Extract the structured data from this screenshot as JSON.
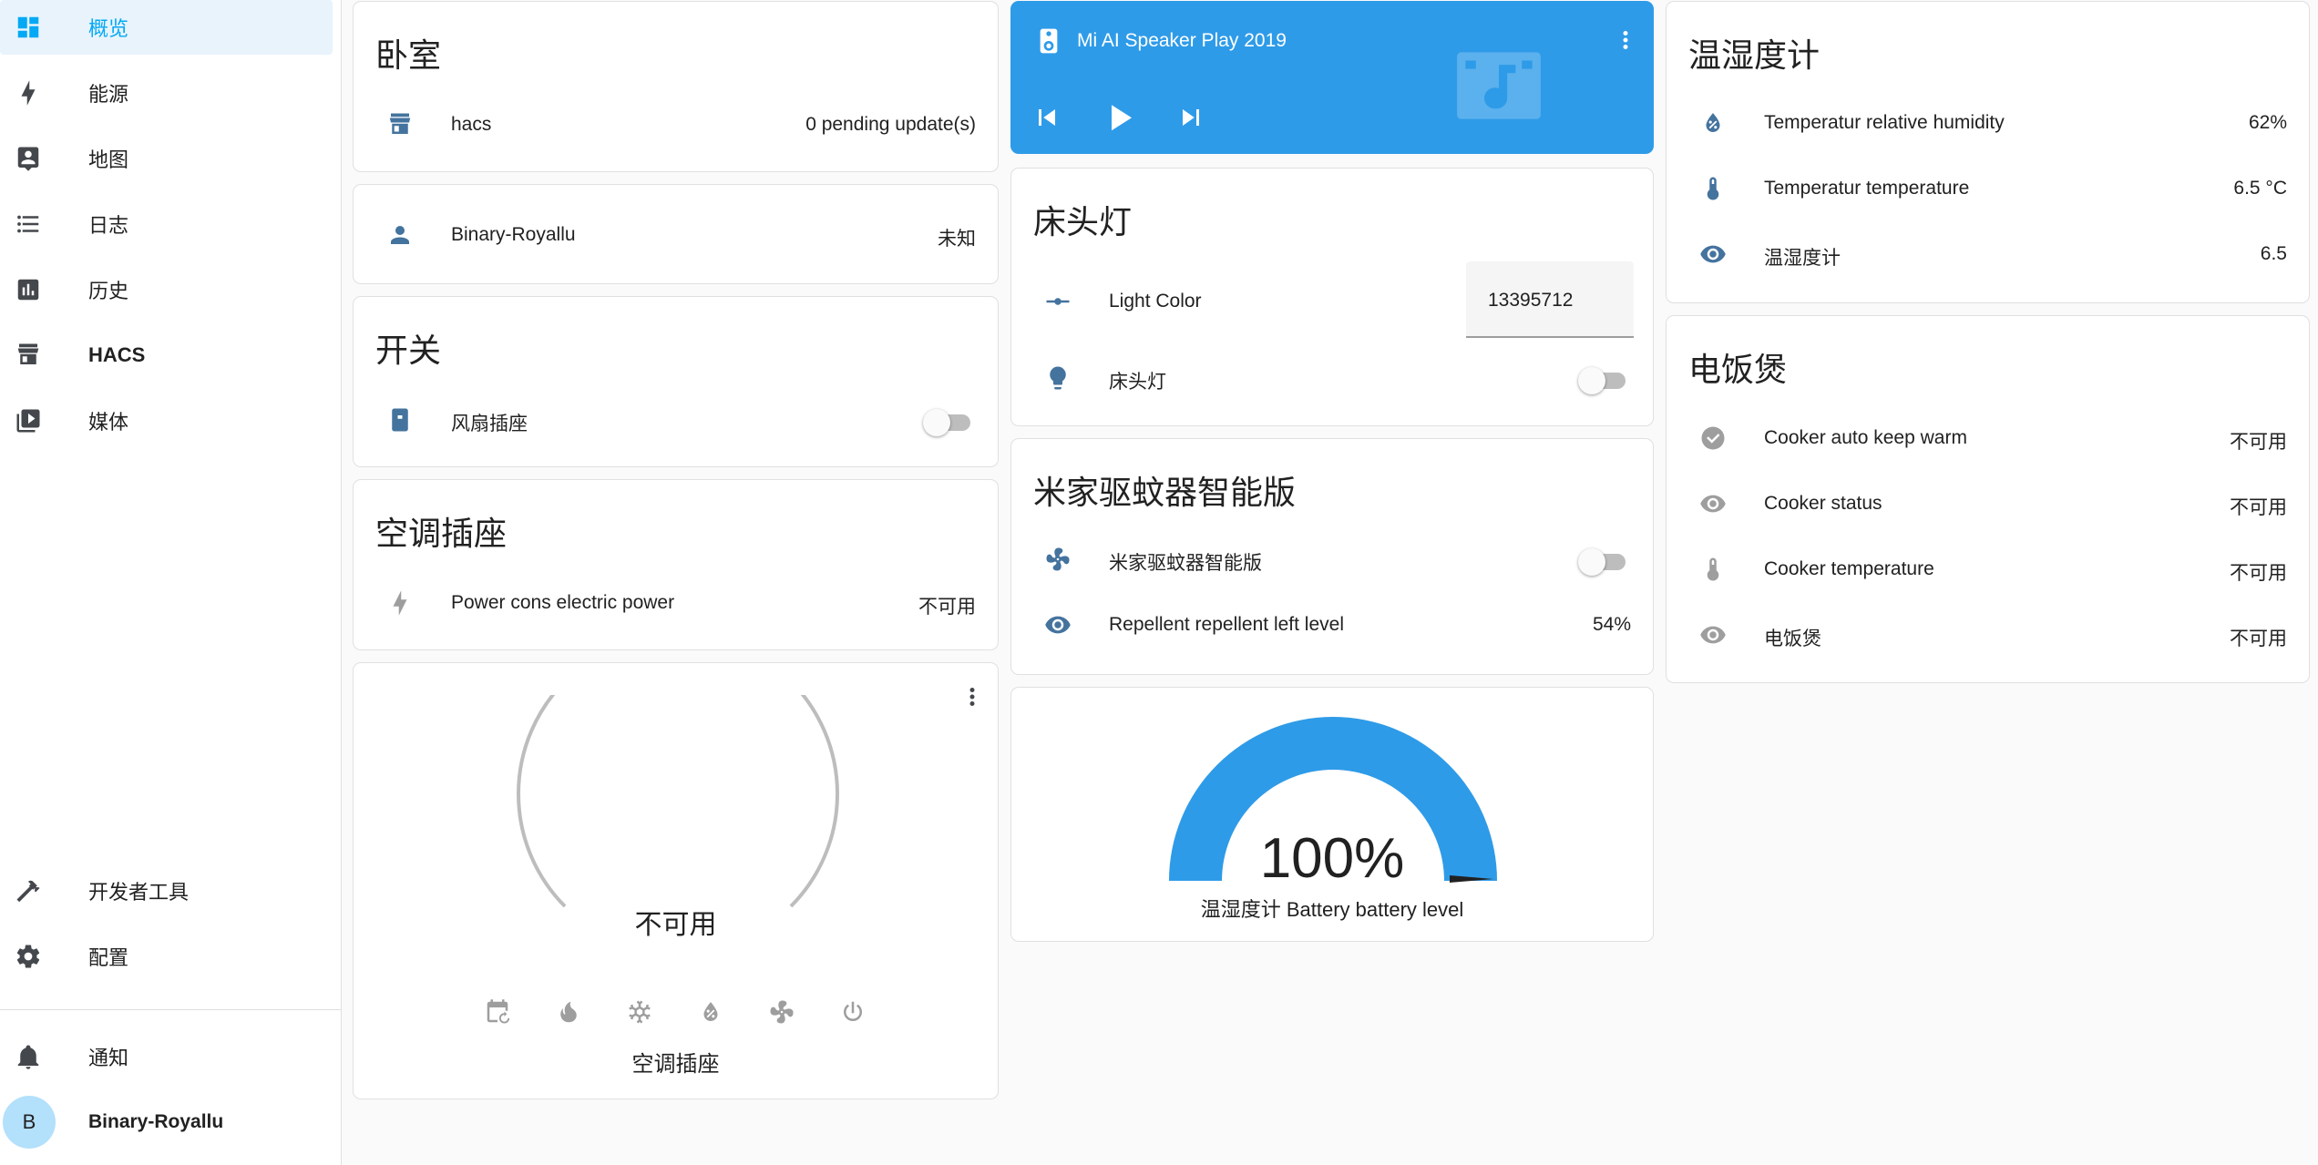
{
  "sidebar": {
    "items": [
      {
        "label": "概览",
        "icon": "dashboard-icon"
      },
      {
        "label": "能源",
        "icon": "lightning-icon"
      },
      {
        "label": "地图",
        "icon": "map-account-icon"
      },
      {
        "label": "日志",
        "icon": "format-list-icon"
      },
      {
        "label": "历史",
        "icon": "chart-box-icon"
      },
      {
        "label": "HACS",
        "icon": "hacs-store-icon"
      },
      {
        "label": "媒体",
        "icon": "play-box-multiple-icon"
      },
      {
        "label": "开发者工具",
        "icon": "hammer-icon"
      },
      {
        "label": "配置",
        "icon": "gear-icon"
      },
      {
        "label": "通知",
        "icon": "bell-icon"
      }
    ],
    "user": {
      "initial": "B",
      "name": "Binary-Royallu"
    },
    "accent": "#03a9f4"
  },
  "bedroom": {
    "title": "卧室",
    "hacs_name": "hacs",
    "hacs_value": "0 pending update(s)"
  },
  "person": {
    "name": "Binary-Royallu",
    "value": "未知"
  },
  "switch_card": {
    "title": "开关",
    "item_name": "风扇插座"
  },
  "ac_plug": {
    "title": "空调插座",
    "item_name": "Power cons electric power",
    "item_value": "不可用"
  },
  "thermostat": {
    "state": "不可用",
    "name": "空调插座",
    "modes": [
      "calendar-sync-icon",
      "fire-icon",
      "snowflake-icon",
      "water-percent-icon",
      "fan-icon",
      "power-icon"
    ]
  },
  "media": {
    "title": "Mi AI Speaker Play 2019",
    "bg_color": "#2e9be8"
  },
  "bedside": {
    "title": "床头灯",
    "light_color_name": "Light Color",
    "light_color_value": "13395712",
    "lamp_name": "床头灯"
  },
  "repeller": {
    "title": "米家驱蚊器智能版",
    "switch_name": "米家驱蚊器智能版",
    "level_name": "Repellent repellent left level",
    "level_value": "54%"
  },
  "gauge": {
    "value_text": "100%",
    "name": "温湿度计 Battery battery level",
    "fraction": 1.0,
    "color": "#2e9be8"
  },
  "hygrometer": {
    "title": "温湿度计",
    "rows": [
      {
        "name": "Temperatur relative humidity",
        "value": "62%"
      },
      {
        "name": "Temperatur temperature",
        "value": "6.5 °C"
      },
      {
        "name": "温湿度计",
        "value": "6.5"
      }
    ]
  },
  "cooker": {
    "title": "电饭煲",
    "rows": [
      {
        "name": "Cooker auto keep warm",
        "value": "不可用"
      },
      {
        "name": "Cooker status",
        "value": "不可用"
      },
      {
        "name": "Cooker temperature",
        "value": "不可用"
      },
      {
        "name": "电饭煲",
        "value": "不可用"
      }
    ]
  }
}
